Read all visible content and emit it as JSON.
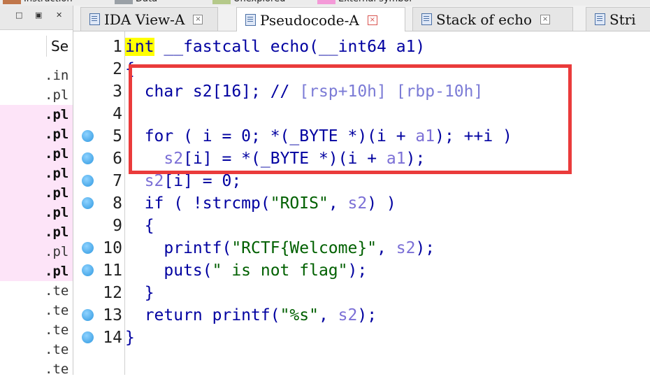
{
  "legend": {
    "items": [
      {
        "label": "Instruction",
        "color": "#c0764a"
      },
      {
        "label": "Data",
        "color": "#9aa0a6"
      },
      {
        "label": "Unexplored",
        "color": "#b5c98a"
      },
      {
        "label": "External symbol",
        "color": "#f49ad8"
      }
    ]
  },
  "left_panel": {
    "window_buttons": [
      "□",
      "▣",
      "✕"
    ],
    "column_header": "Se",
    "segments": [
      {
        "text": ".in",
        "pink": false,
        "bold": false
      },
      {
        "text": ".pl",
        "pink": false,
        "bold": false
      },
      {
        "text": ".pl",
        "pink": true,
        "bold": true
      },
      {
        "text": ".pl",
        "pink": true,
        "bold": true
      },
      {
        "text": ".pl",
        "pink": true,
        "bold": true
      },
      {
        "text": ".pl",
        "pink": true,
        "bold": true
      },
      {
        "text": ".pl",
        "pink": true,
        "bold": true
      },
      {
        "text": ".pl",
        "pink": true,
        "bold": true
      },
      {
        "text": ".pl",
        "pink": true,
        "bold": true
      },
      {
        "text": ".pl",
        "pink": true,
        "bold": false
      },
      {
        "text": ".pl",
        "pink": true,
        "bold": true
      },
      {
        "text": ".te",
        "pink": false,
        "bold": false
      },
      {
        "text": ".te",
        "pink": false,
        "bold": false
      },
      {
        "text": ".te",
        "pink": false,
        "bold": false
      },
      {
        "text": ".te",
        "pink": false,
        "bold": false
      },
      {
        "text": ".te",
        "pink": false,
        "bold": false
      }
    ]
  },
  "tabs": [
    {
      "label": "IDA View-A",
      "active": false
    },
    {
      "label": "Pseudocode-A",
      "active": true
    },
    {
      "label": "Stack of echo",
      "active": false
    },
    {
      "label": "Stri",
      "active": false
    }
  ],
  "code": {
    "lines": [
      {
        "n": "1",
        "dot": false,
        "parts": [
          [
            "kw",
            "int"
          ],
          [
            "p",
            " __fastcall echo(__int64 a1)"
          ]
        ]
      },
      {
        "n": "2",
        "dot": false,
        "parts": [
          [
            "p",
            "{"
          ]
        ]
      },
      {
        "n": "3",
        "dot": false,
        "parts": [
          [
            "p",
            "  char s2[16]; // "
          ],
          [
            "com",
            "[rsp+10h] [rbp-10h]"
          ]
        ]
      },
      {
        "n": "4",
        "dot": false,
        "parts": [
          [
            "p",
            ""
          ]
        ]
      },
      {
        "n": "5",
        "dot": true,
        "parts": [
          [
            "p",
            "  for ( i = 0; *(_BYTE *)(i + "
          ],
          [
            "var",
            "a1"
          ],
          [
            "p",
            "); ++i )"
          ]
        ]
      },
      {
        "n": "6",
        "dot": true,
        "parts": [
          [
            "p",
            "    "
          ],
          [
            "var",
            "s2"
          ],
          [
            "p",
            "[i] = *(_BYTE *)(i + "
          ],
          [
            "var",
            "a1"
          ],
          [
            "p",
            ");"
          ]
        ]
      },
      {
        "n": "7",
        "dot": true,
        "parts": [
          [
            "p",
            "  "
          ],
          [
            "var",
            "s2"
          ],
          [
            "p",
            "[i] = 0;"
          ]
        ]
      },
      {
        "n": "8",
        "dot": true,
        "parts": [
          [
            "p",
            "  if ( !strcmp("
          ],
          [
            "str",
            "\"ROIS\""
          ],
          [
            "p",
            ", "
          ],
          [
            "var",
            "s2"
          ],
          [
            "p",
            ") )"
          ]
        ]
      },
      {
        "n": "9",
        "dot": false,
        "parts": [
          [
            "p",
            "  {"
          ]
        ]
      },
      {
        "n": "10",
        "dot": true,
        "parts": [
          [
            "p",
            "    printf("
          ],
          [
            "str",
            "\"RCTF{Welcome}\""
          ],
          [
            "p",
            ", "
          ],
          [
            "var",
            "s2"
          ],
          [
            "p",
            ");"
          ]
        ]
      },
      {
        "n": "11",
        "dot": true,
        "parts": [
          [
            "p",
            "    puts("
          ],
          [
            "str",
            "\" is not flag\""
          ],
          [
            "p",
            ");"
          ]
        ]
      },
      {
        "n": "12",
        "dot": false,
        "parts": [
          [
            "p",
            "  }"
          ]
        ]
      },
      {
        "n": "13",
        "dot": true,
        "parts": [
          [
            "p",
            "  return printf("
          ],
          [
            "str",
            "\"%s\""
          ],
          [
            "p",
            ", "
          ],
          [
            "var",
            "s2"
          ],
          [
            "p",
            ");"
          ]
        ]
      },
      {
        "n": "14",
        "dot": true,
        "parts": [
          [
            "p",
            "}"
          ]
        ]
      }
    ]
  },
  "colors": {
    "highlight_box": "#ea3b3b",
    "keyword_bg": "#ffff00",
    "segment_pink": "#fde4f8"
  }
}
